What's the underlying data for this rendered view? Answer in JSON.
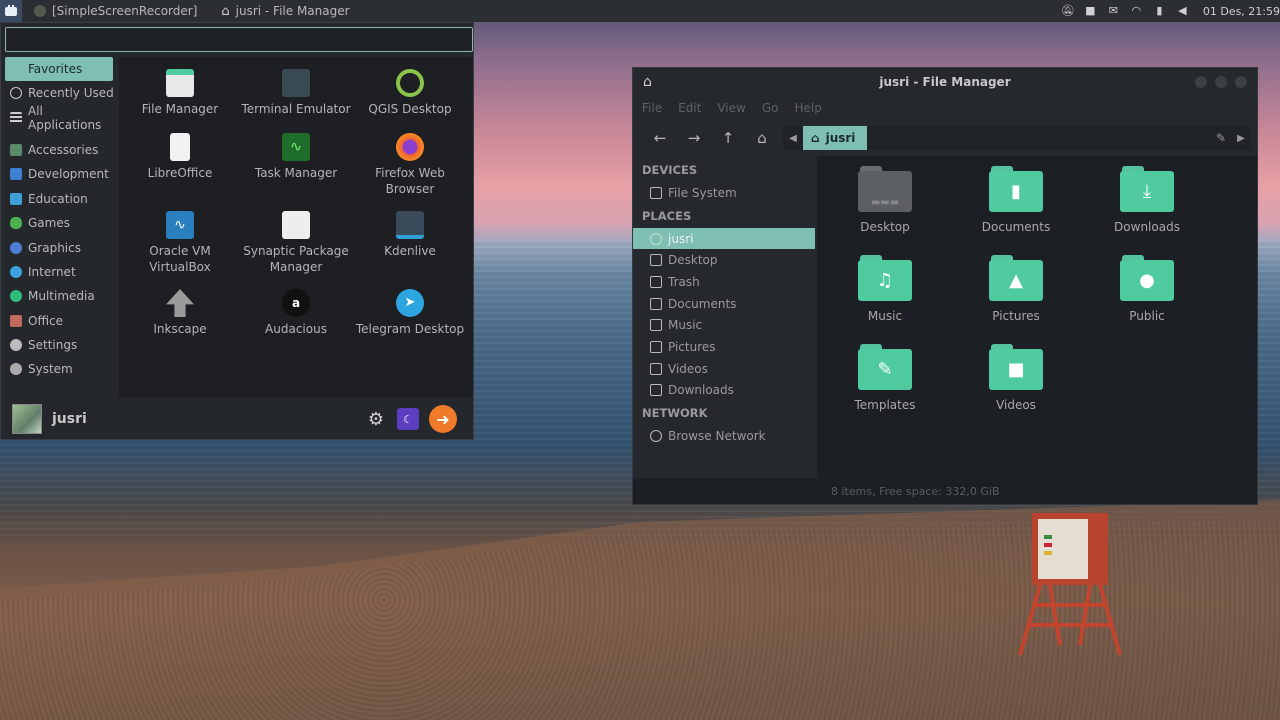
{
  "panel": {
    "tasks": [
      {
        "label": "[SimpleScreenRecorder]"
      },
      {
        "label": "jusri - File Manager"
      }
    ],
    "clock": "01 Des, 21:59"
  },
  "menu": {
    "search_placeholder": "",
    "categories": [
      {
        "label": "Favorites"
      },
      {
        "label": "Recently Used"
      },
      {
        "label": "All Applications"
      },
      {
        "label": "Accessories"
      },
      {
        "label": "Development"
      },
      {
        "label": "Education"
      },
      {
        "label": "Games"
      },
      {
        "label": "Graphics"
      },
      {
        "label": "Internet"
      },
      {
        "label": "Multimedia"
      },
      {
        "label": "Office"
      },
      {
        "label": "Settings"
      },
      {
        "label": "System"
      }
    ],
    "apps": [
      {
        "label": "File Manager"
      },
      {
        "label": "Terminal Emulator"
      },
      {
        "label": "QGIS Desktop"
      },
      {
        "label": "LibreOffice"
      },
      {
        "label": "Task Manager"
      },
      {
        "label": "Firefox Web Browser"
      },
      {
        "label": "Oracle VM VirtualBox"
      },
      {
        "label": "Synaptic Package Manager"
      },
      {
        "label": "Kdenlive"
      },
      {
        "label": "Inkscape"
      },
      {
        "label": "Audacious"
      },
      {
        "label": "Telegram Desktop"
      }
    ],
    "username": "jusri",
    "accent": "#7fbfb2"
  },
  "fm": {
    "title": "jusri - File Manager",
    "menubar": [
      "File",
      "Edit",
      "View",
      "Go",
      "Help"
    ],
    "path": "jusri",
    "sections": {
      "devices": "DEVICES",
      "places": "PLACES",
      "network": "NETWORK"
    },
    "devices": [
      {
        "label": "File System"
      }
    ],
    "places": [
      {
        "label": "jusri"
      },
      {
        "label": "Desktop"
      },
      {
        "label": "Trash"
      },
      {
        "label": "Documents"
      },
      {
        "label": "Music"
      },
      {
        "label": "Pictures"
      },
      {
        "label": "Videos"
      },
      {
        "label": "Downloads"
      }
    ],
    "network": [
      {
        "label": "Browse Network"
      }
    ],
    "items": [
      {
        "label": "Desktop"
      },
      {
        "label": "Documents"
      },
      {
        "label": "Downloads"
      },
      {
        "label": "Music"
      },
      {
        "label": "Pictures"
      },
      {
        "label": "Public"
      },
      {
        "label": "Templates"
      },
      {
        "label": "Videos"
      }
    ],
    "status": "8 items, Free space: 332,0 GiB",
    "folder_color": "#4fcb9f"
  }
}
